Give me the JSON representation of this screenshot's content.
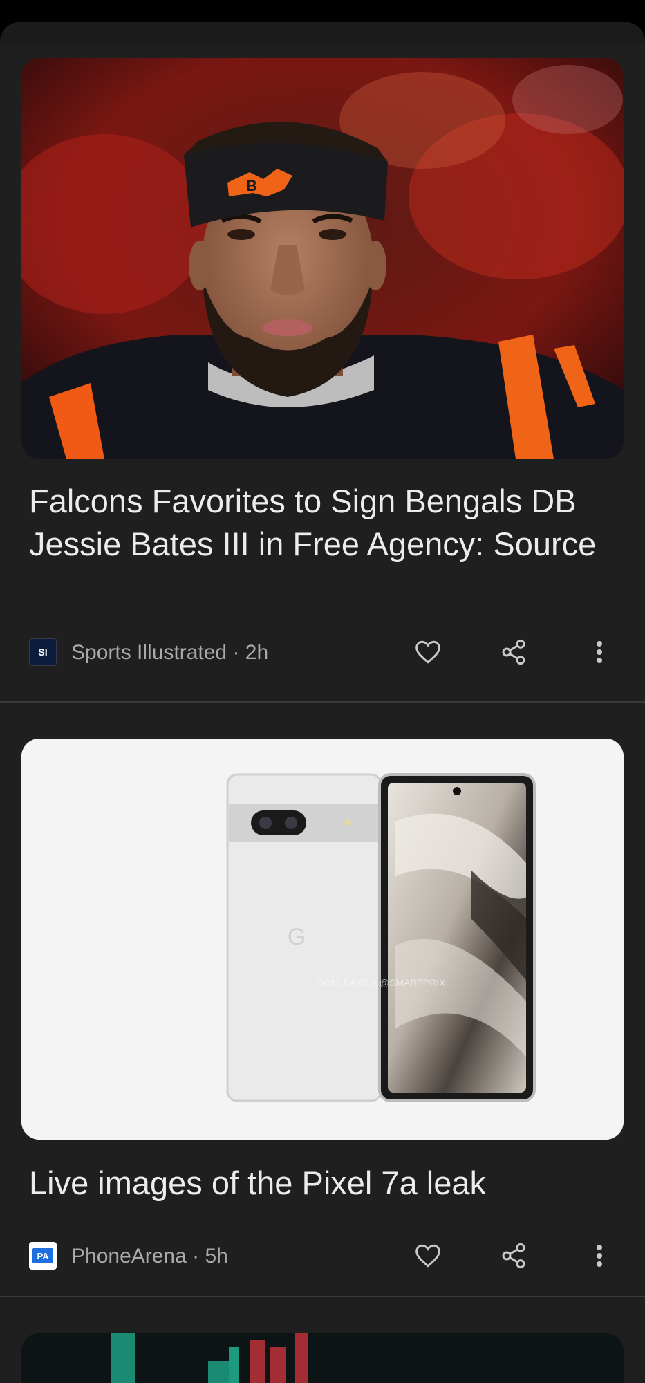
{
  "feed": {
    "articles": [
      {
        "headline": "Falcons Favorites to Sign Bengals DB Jessie Bates III in Free Agency: Source",
        "source": "Sports Illustrated",
        "age": "2h",
        "logo_text": "SI",
        "logo_color": "#0b1c3d",
        "image": "football-player-photo"
      },
      {
        "headline": "Live images of the Pixel 7a leak",
        "source": "PhoneArena",
        "age": "5h",
        "logo_text": "PA",
        "logo_color": "#1f6fe0",
        "image": "pixel-phone-photo",
        "watermark": "©ONLEAKS x @SMARTPRIX"
      }
    ]
  },
  "icons": {
    "like": "heart-icon",
    "share": "share-icon",
    "more": "more-vert-icon"
  },
  "colors": {
    "background": "#1f1f1f",
    "headline": "#ececec",
    "meta": "#a9a9a9"
  }
}
